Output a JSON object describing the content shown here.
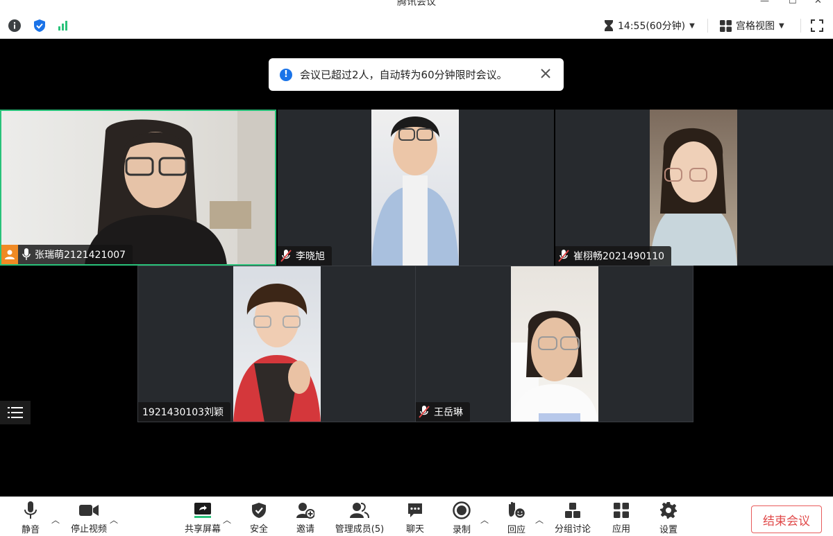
{
  "app": {
    "title": "腾讯会议"
  },
  "topbar": {
    "timer": "14:55(60分钟)",
    "view_label": "宫格视图"
  },
  "notice": {
    "text": "会议已超过2人，自动转为60分钟限时会议。"
  },
  "participants": [
    {
      "name": "张瑞萌2121421007",
      "mic": "on",
      "host": true,
      "active_speaker": true
    },
    {
      "name": "李晓旭",
      "mic": "muted"
    },
    {
      "name": "崔栩畅2021490110",
      "mic": "muted"
    },
    {
      "name": "1921430103刘颖",
      "mic": "none"
    },
    {
      "name": "王岳琳",
      "mic": "muted"
    }
  ],
  "toolbar": {
    "mute": "静音",
    "stop_video": "停止视频",
    "share_screen": "共享屏幕",
    "security": "安全",
    "invite": "邀请",
    "manage_members": "管理成员(5)",
    "chat": "聊天",
    "record": "录制",
    "react": "回应",
    "breakout": "分组讨论",
    "apps": "应用",
    "settings": "设置",
    "end_meeting": "结束会议"
  },
  "colors": {
    "accent_green": "#29c27a",
    "end_red": "#e04848",
    "info_blue": "#1a73e8",
    "host_orange": "#f08a24"
  }
}
